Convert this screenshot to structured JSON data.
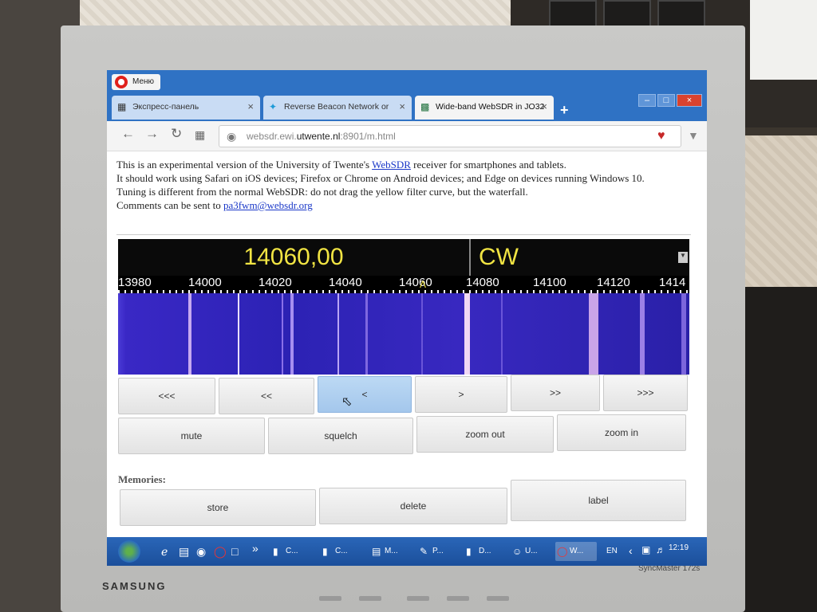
{
  "browser": {
    "menu_button": "Меню",
    "tabs": [
      {
        "label": "Экспресс-панель",
        "icon": "grid-icon"
      },
      {
        "label": "Reverse Beacon Network or",
        "icon": "beacon-icon"
      },
      {
        "label": "Wide-band WebSDR in JO32",
        "icon": "websdr-icon"
      }
    ],
    "url_prefix": "websdr.ewi.",
    "url_host": "utwente.nl",
    "url_suffix": ":8901/m.html"
  },
  "intro": {
    "line1_a": "This is an experimental version of the University of Twente's ",
    "line1_link": "WebSDR",
    "line1_b": " receiver for smartphones and tablets.",
    "line2": "It should work using Safari on iOS devices; Firefox or Chrome on Android devices; and Edge on devices running Windows 10.",
    "line3": "Tuning is different from the normal WebSDR: do not drag the yellow filter curve, but the waterfall.",
    "line4_a": "Comments can be sent to ",
    "line4_link": "pa3fwm@websdr.org"
  },
  "receiver": {
    "frequency": "14060,00",
    "mode": "CW",
    "scale_ticks": [
      "13980",
      "14000",
      "14020",
      "14040",
      "14060",
      "14080",
      "14100",
      "14120",
      "1414"
    ]
  },
  "tuning_buttons": [
    "<<<",
    "<<",
    "<",
    ">",
    ">>",
    ">>>"
  ],
  "control_buttons": [
    "mute",
    "squelch",
    "zoom out",
    "zoom in"
  ],
  "memories": {
    "heading": "Memories:",
    "buttons": [
      "store",
      "delete",
      "label"
    ]
  },
  "taskbar": {
    "items": [
      "C...",
      "C...",
      "M...",
      "P...",
      "D...",
      "U...",
      "W..."
    ],
    "language": "EN",
    "clock": "12:19"
  },
  "monitor": {
    "brand": "SAMSUNG",
    "model": "SyncMaster 172s"
  },
  "colors": {
    "readout_text": "#f1e443",
    "waterfall": "#3a28c6",
    "titlebar": "#2f72c4"
  }
}
